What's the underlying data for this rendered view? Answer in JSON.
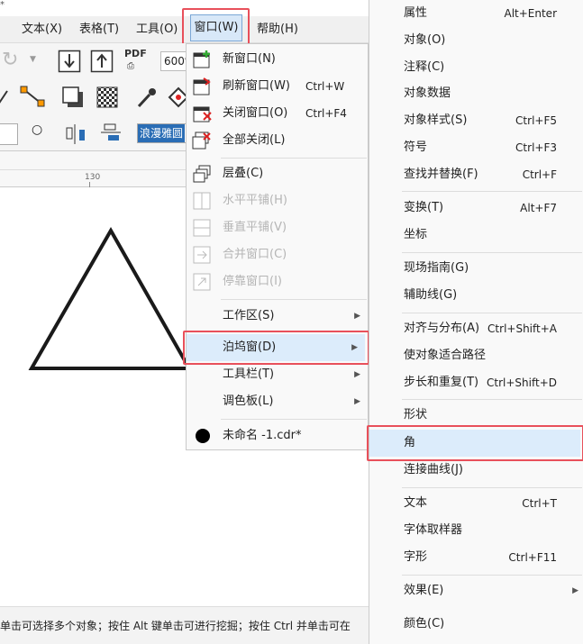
{
  "title_fragment": "*",
  "menubar": [
    {
      "label": "文本(X)"
    },
    {
      "label": "表格(T)"
    },
    {
      "label": "工具(O)"
    },
    {
      "label": "窗口(W)"
    },
    {
      "label": "帮助(H)"
    }
  ],
  "toolbar": {
    "zoom": "600%",
    "pdf": "PDF"
  },
  "propbar": {
    "font": "浪漫雅圆"
  },
  "ruler": {
    "tick": "130"
  },
  "status": "单击可选择多个对象；按住 Alt 键单击可进行挖掘；按住 Ctrl 并单击可在",
  "window_menu": [
    {
      "label": "新窗口(N)",
      "shortcut": ""
    },
    {
      "label": "刷新窗口(W)",
      "shortcut": "Ctrl+W"
    },
    {
      "label": "关闭窗口(O)",
      "shortcut": "Ctrl+F4"
    },
    {
      "label": "全部关闭(L)",
      "shortcut": ""
    },
    {
      "label": "层叠(C)",
      "shortcut": ""
    },
    {
      "label": "水平平铺(H)",
      "shortcut": ""
    },
    {
      "label": "垂直平铺(V)",
      "shortcut": ""
    },
    {
      "label": "合并窗口(C)",
      "shortcut": ""
    },
    {
      "label": "停靠窗口(I)",
      "shortcut": ""
    },
    {
      "label": "工作区(S)",
      "shortcut": ""
    },
    {
      "label": "泊坞窗(D)",
      "shortcut": ""
    },
    {
      "label": "工具栏(T)",
      "shortcut": ""
    },
    {
      "label": "调色板(L)",
      "shortcut": ""
    },
    {
      "label": "未命名 -1.cdr*",
      "shortcut": ""
    }
  ],
  "docker_menu": [
    {
      "label": "属性",
      "shortcut": "Alt+Enter"
    },
    {
      "label": "对象(O)",
      "shortcut": ""
    },
    {
      "label": "注释(C)",
      "shortcut": ""
    },
    {
      "label": "对象数据",
      "shortcut": ""
    },
    {
      "label": "对象样式(S)",
      "shortcut": "Ctrl+F5"
    },
    {
      "label": "符号",
      "shortcut": "Ctrl+F3"
    },
    {
      "label": "查找并替换(F)",
      "shortcut": "Ctrl+F"
    },
    {
      "label": "变换(T)",
      "shortcut": "Alt+F7"
    },
    {
      "label": "坐标",
      "shortcut": ""
    },
    {
      "label": "现场指南(G)",
      "shortcut": ""
    },
    {
      "label": "辅助线(G)",
      "shortcut": ""
    },
    {
      "label": "对齐与分布(A)",
      "shortcut": "Ctrl+Shift+A"
    },
    {
      "label": "使对象适合路径",
      "shortcut": ""
    },
    {
      "label": "步长和重复(T)",
      "shortcut": "Ctrl+Shift+D"
    },
    {
      "label": "形状",
      "shortcut": ""
    },
    {
      "label": "角",
      "shortcut": ""
    },
    {
      "label": "连接曲线(J)",
      "shortcut": ""
    },
    {
      "label": "文本",
      "shortcut": "Ctrl+T"
    },
    {
      "label": "字体取样器",
      "shortcut": ""
    },
    {
      "label": "字形",
      "shortcut": "Ctrl+F11"
    },
    {
      "label": "效果(E)",
      "shortcut": ""
    },
    {
      "label": "颜色(C)",
      "shortcut": ""
    }
  ],
  "colors": {
    "highlight": "#dcecfb",
    "accent_border": "#e8505b",
    "icon_blue": "#2a6db5"
  }
}
